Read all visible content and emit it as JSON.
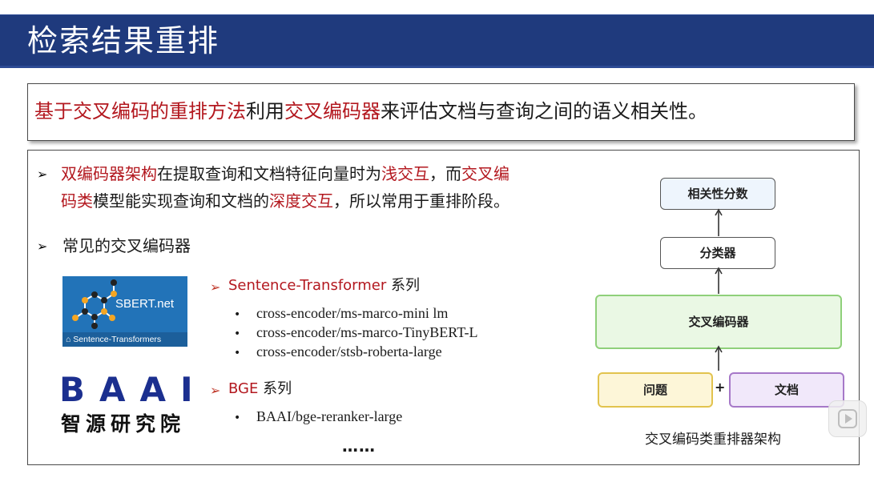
{
  "slide": {
    "title": "检索结果重排",
    "summary": {
      "part1": "基于交叉编码的重排方法",
      "part2": "利用",
      "part3": "交叉编码器",
      "part4": "来评估文档与查询之间的语义相关性。"
    },
    "bullet1": {
      "line1_a": "双编码器架构",
      "line1_b": "在提取查询和文档特征向量时为",
      "line1_c": "浅交互",
      "line1_d": "，而",
      "line1_e": "交叉编",
      "line2_a": "码类",
      "line2_b": "模型能实现查询和文档的",
      "line2_c": "深度交互",
      "line2_d": "，所以常用于重排阶段。"
    },
    "bullet2": "常见的交叉编码器",
    "sentence_transformer": {
      "name": "Sentence-Transformer",
      "suffix": " 系列",
      "models": [
        "cross-encoder/ms-marco-mini lm",
        "cross-encoder/ms-marco-TinyBERT-L",
        "cross-encoder/stsb-roberta-large"
      ]
    },
    "bge": {
      "name": "BGE",
      "suffix": " 系列",
      "models": [
        "BAAI/bge-reranker-large"
      ]
    },
    "ellipsis": "……",
    "logos": {
      "sbert_text": "SBERT.net",
      "sbert_footer": "Sentence-Transformers",
      "baai_text": "BAAI",
      "baai_cn": "智源研究院"
    },
    "diagram": {
      "score": "相关性分数",
      "classifier": "分类器",
      "encoder": "交叉编码器",
      "question": "问题",
      "plus": "+",
      "document": "文档",
      "caption": "交叉编码类重排器架构"
    },
    "colors": {
      "title_bar": "#1f3a7d",
      "highlight_red": "#b3181f",
      "score_box": "#eef5fd",
      "encoder_box": "#eaf8e4",
      "question_box": "#fdf6d8",
      "document_box": "#f1e8fa"
    }
  }
}
